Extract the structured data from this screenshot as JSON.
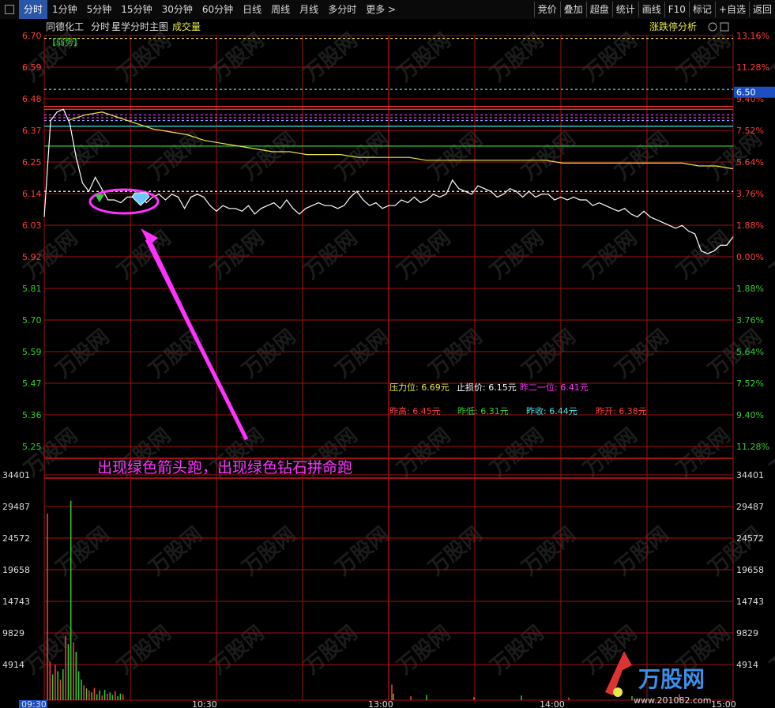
{
  "toolbar": {
    "tabs": [
      "分时",
      "1分钟",
      "5分钟",
      "15分钟",
      "30分钟",
      "60分钟",
      "日线",
      "周线",
      "月线",
      "多分时",
      "更多 >"
    ],
    "active_index": 0,
    "right_buttons": [
      "竞价",
      "叠加",
      "超盘",
      "统计",
      "画线",
      "F10",
      "标记",
      "+自选",
      "返回"
    ]
  },
  "chart_header": {
    "stock_name": "同德化工",
    "mode": "分时",
    "indicator": "星学分时主图",
    "volume_label": "成交量",
    "right_label": "涨跌停分析",
    "signal_badge": "【弱势】"
  },
  "colors": {
    "up": "#ff3c3c",
    "down": "#33cc33",
    "price_line": "#ffffff",
    "avg_line": "#e8e84a",
    "grid": "#a01010",
    "annotation": "#ff33ff",
    "yellow": "#e8e84a",
    "cyan": "#49e3e3"
  },
  "price_axis": {
    "left_ticks": [
      "6.70",
      "6.59",
      "6.48",
      "6.37",
      "6.25",
      "6.14",
      "6.03",
      "5.92",
      "5.81",
      "5.70",
      "5.59",
      "5.47",
      "5.36",
      "5.25"
    ],
    "right_ticks": [
      "13.16%",
      "11.28%",
      "9.40%",
      "7.52%",
      "5.64%",
      "3.76%",
      "1.88%",
      "0.00%",
      "1.88%",
      "3.76%",
      "5.64%",
      "7.52%",
      "9.40%",
      "11.28%"
    ],
    "current_price": "6.50"
  },
  "volume_axis": {
    "ticks": [
      "34401",
      "29487",
      "24572",
      "19658",
      "14743",
      "9829",
      "4914"
    ]
  },
  "time_axis": {
    "labels": [
      "09:30",
      "10:30",
      "13:00",
      "14:00",
      "15:00"
    ]
  },
  "info_row1": [
    {
      "label": "压力位:",
      "value": "6.69元",
      "color": "#e8e84a"
    },
    {
      "label": "止损价:",
      "value": "6.15元",
      "color": "#ffffff"
    },
    {
      "label": "昨二一位:",
      "value": "6.41元",
      "color": "#ff33ff"
    }
  ],
  "info_row2": [
    {
      "label": "昨高:",
      "value": "6.45元",
      "color": "#ff3c3c"
    },
    {
      "label": "昨低:",
      "value": "6.31元",
      "color": "#33cc33"
    },
    {
      "label": "昨收:",
      "value": "6.44元",
      "color": "#49e3e3"
    },
    {
      "label": "昨开:",
      "value": "6.38元",
      "color": "#ff3c3c"
    }
  ],
  "annotation_text": "出现绿色箭头跑，出现绿色钻石拼命跑",
  "watermark": {
    "brand": "万股网",
    "url": "www.201082.com"
  },
  "chart_data": {
    "type": "line",
    "price_range": [
      5.25,
      6.7
    ],
    "zero_pct_price": 5.92,
    "price_series": [
      6.06,
      6.4,
      6.43,
      6.44,
      6.39,
      6.27,
      6.18,
      6.15,
      6.2,
      6.16,
      6.12,
      6.12,
      6.11,
      6.13,
      6.13,
      6.14,
      6.11,
      6.13,
      6.14,
      6.12,
      6.14,
      6.13,
      6.09,
      6.13,
      6.14,
      6.13,
      6.1,
      6.08,
      6.1,
      6.09,
      6.09,
      6.08,
      6.1,
      6.07,
      6.09,
      6.1,
      6.11,
      6.09,
      6.12,
      6.09,
      6.07,
      6.09,
      6.1,
      6.11,
      6.1,
      6.1,
      6.09,
      6.1,
      6.13,
      6.15,
      6.12,
      6.1,
      6.11,
      6.09,
      6.1,
      6.1,
      6.12,
      6.11,
      6.13,
      6.11,
      6.12,
      6.14,
      6.13,
      6.14,
      6.19,
      6.16,
      6.15,
      6.14,
      6.17,
      6.16,
      6.15,
      6.13,
      6.14,
      6.16,
      6.15,
      6.13,
      6.15,
      6.13,
      6.14,
      6.14,
      6.12,
      6.13,
      6.12,
      6.13,
      6.12,
      6.12,
      6.1,
      6.11,
      6.1,
      6.09,
      6.08,
      6.09,
      6.07,
      6.06,
      6.08,
      6.06,
      6.05,
      6.04,
      6.03,
      6.02,
      6.03,
      6.01,
      6.0,
      5.94,
      5.93,
      5.94,
      5.96,
      5.96,
      5.99
    ],
    "avg_series": [
      6.4,
      6.42,
      6.43,
      6.41,
      6.39,
      6.37,
      6.36,
      6.35,
      6.33,
      6.32,
      6.31,
      6.3,
      6.29,
      6.29,
      6.28,
      6.28,
      6.28,
      6.27,
      6.27,
      6.27,
      6.27,
      6.26,
      6.26,
      6.26,
      6.26,
      6.26,
      6.26,
      6.26,
      6.26,
      6.25,
      6.25,
      6.25,
      6.25,
      6.25,
      6.25,
      6.25,
      6.25,
      6.24,
      6.24,
      6.23
    ],
    "reference_lines": [
      {
        "price": 6.69,
        "color": "#e8e84a",
        "style": "dashed"
      },
      {
        "price": 6.51,
        "color": "#49e3e3",
        "style": "dashed"
      },
      {
        "price": 6.45,
        "color": "#ff3c3c",
        "style": "solid"
      },
      {
        "price": 6.44,
        "color": "#ff3c3c",
        "style": "solid"
      },
      {
        "price": 6.42,
        "color": "#ff33ff",
        "style": "dashed"
      },
      {
        "price": 6.41,
        "color": "#ff33ff",
        "style": "dashed"
      },
      {
        "price": 6.4,
        "color": "#9999ff",
        "style": "dashed"
      },
      {
        "price": 6.38,
        "color": "#49e3e3",
        "style": "solid"
      },
      {
        "price": 6.31,
        "color": "#33cc33",
        "style": "solid"
      },
      {
        "price": 6.15,
        "color": "#ffffff",
        "style": "dashed"
      }
    ],
    "volume_range": [
      0,
      34401
    ],
    "volume_series": [
      {
        "v": 29000,
        "c": "up"
      },
      {
        "v": 6000,
        "c": "up"
      },
      {
        "v": 4000,
        "c": "down"
      },
      {
        "v": 5500,
        "c": "up"
      },
      {
        "v": 4500,
        "c": "down"
      },
      {
        "v": 3200,
        "c": "up"
      },
      {
        "v": 4800,
        "c": "down"
      },
      {
        "v": 10000,
        "c": "up"
      },
      {
        "v": 8700,
        "c": "down"
      },
      {
        "v": 31000,
        "c": "down"
      },
      {
        "v": 9000,
        "c": "up"
      },
      {
        "v": 7500,
        "c": "down"
      },
      {
        "v": 4500,
        "c": "down"
      },
      {
        "v": 3200,
        "c": "down"
      },
      {
        "v": 2300,
        "c": "up"
      },
      {
        "v": 1800,
        "c": "down"
      },
      {
        "v": 1500,
        "c": "up"
      },
      {
        "v": 1200,
        "c": "down"
      },
      {
        "v": 1900,
        "c": "up"
      },
      {
        "v": 900,
        "c": "down"
      },
      {
        "v": 1500,
        "c": "down"
      },
      {
        "v": 700,
        "c": "up"
      },
      {
        "v": 1600,
        "c": "down"
      },
      {
        "v": 1000,
        "c": "up"
      },
      {
        "v": 1200,
        "c": "down"
      },
      {
        "v": 800,
        "c": "down"
      },
      {
        "v": 1400,
        "c": "up"
      },
      {
        "v": 600,
        "c": "down"
      },
      {
        "v": 1000,
        "c": "down"
      },
      {
        "v": 900,
        "c": "up"
      }
    ]
  }
}
